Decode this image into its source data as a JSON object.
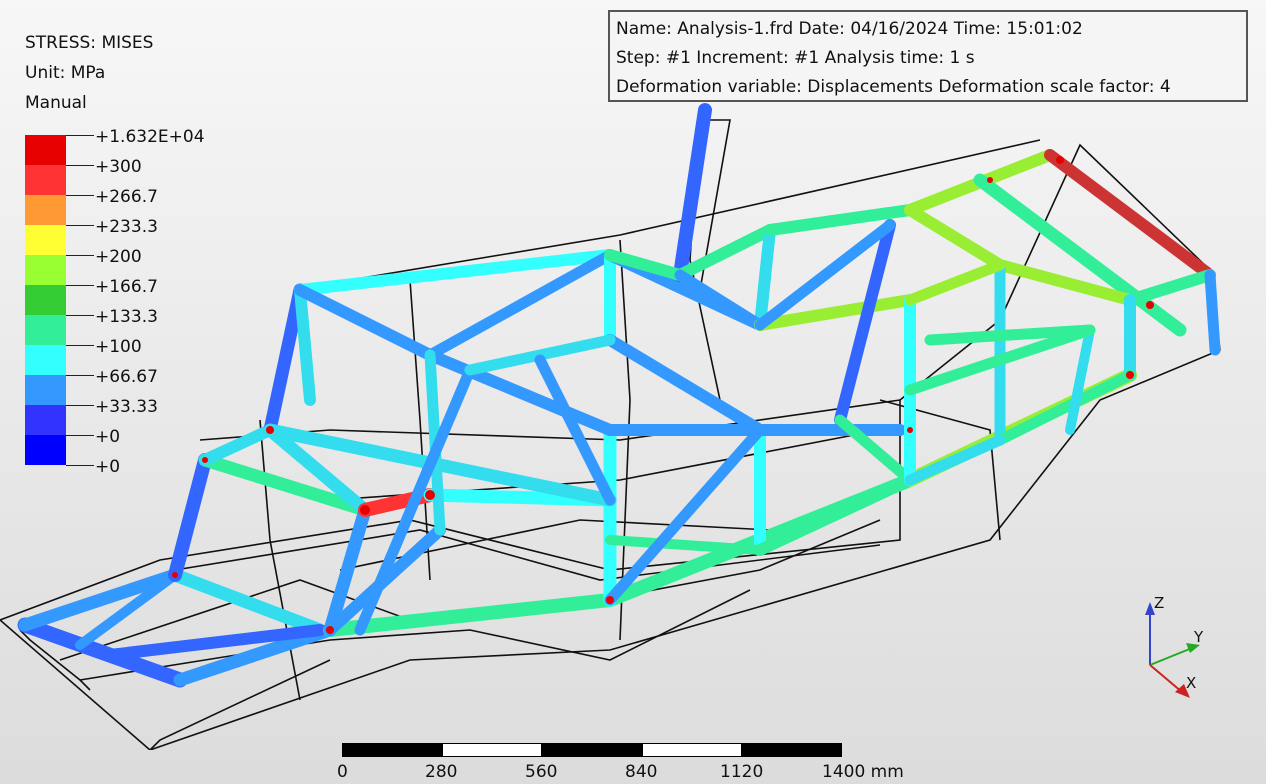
{
  "legend": {
    "variable": "STRESS: MISES",
    "unit": "Unit: MPa",
    "mode": "Manual",
    "levels": [
      "+1.632E+04",
      "+300",
      "+266.7",
      "+233.3",
      "+200",
      "+166.7",
      "+133.3",
      "+100",
      "+66.67",
      "+33.33",
      "+0",
      "+0"
    ],
    "colors": [
      "#e60000",
      "#ff3333",
      "#ff9933",
      "#ffff33",
      "#99ff33",
      "#33cc33",
      "#33ee99",
      "#33ffff",
      "#3399ff",
      "#3333ff",
      "#0000ff"
    ]
  },
  "info": {
    "line1": "Name: Analysis-1.frd   Date: 04/16/2024   Time: 15:01:02",
    "line2": "Step: #1   Increment: #1   Analysis time: 1 s",
    "line3": "Deformation variable: Displacements   Deformation scale factor: 4"
  },
  "axes": {
    "z": "Z",
    "y": "Y",
    "x": "X"
  },
  "scale": {
    "ticks": [
      "0",
      "280",
      "560",
      "840",
      "1120",
      "1400 mm"
    ]
  }
}
